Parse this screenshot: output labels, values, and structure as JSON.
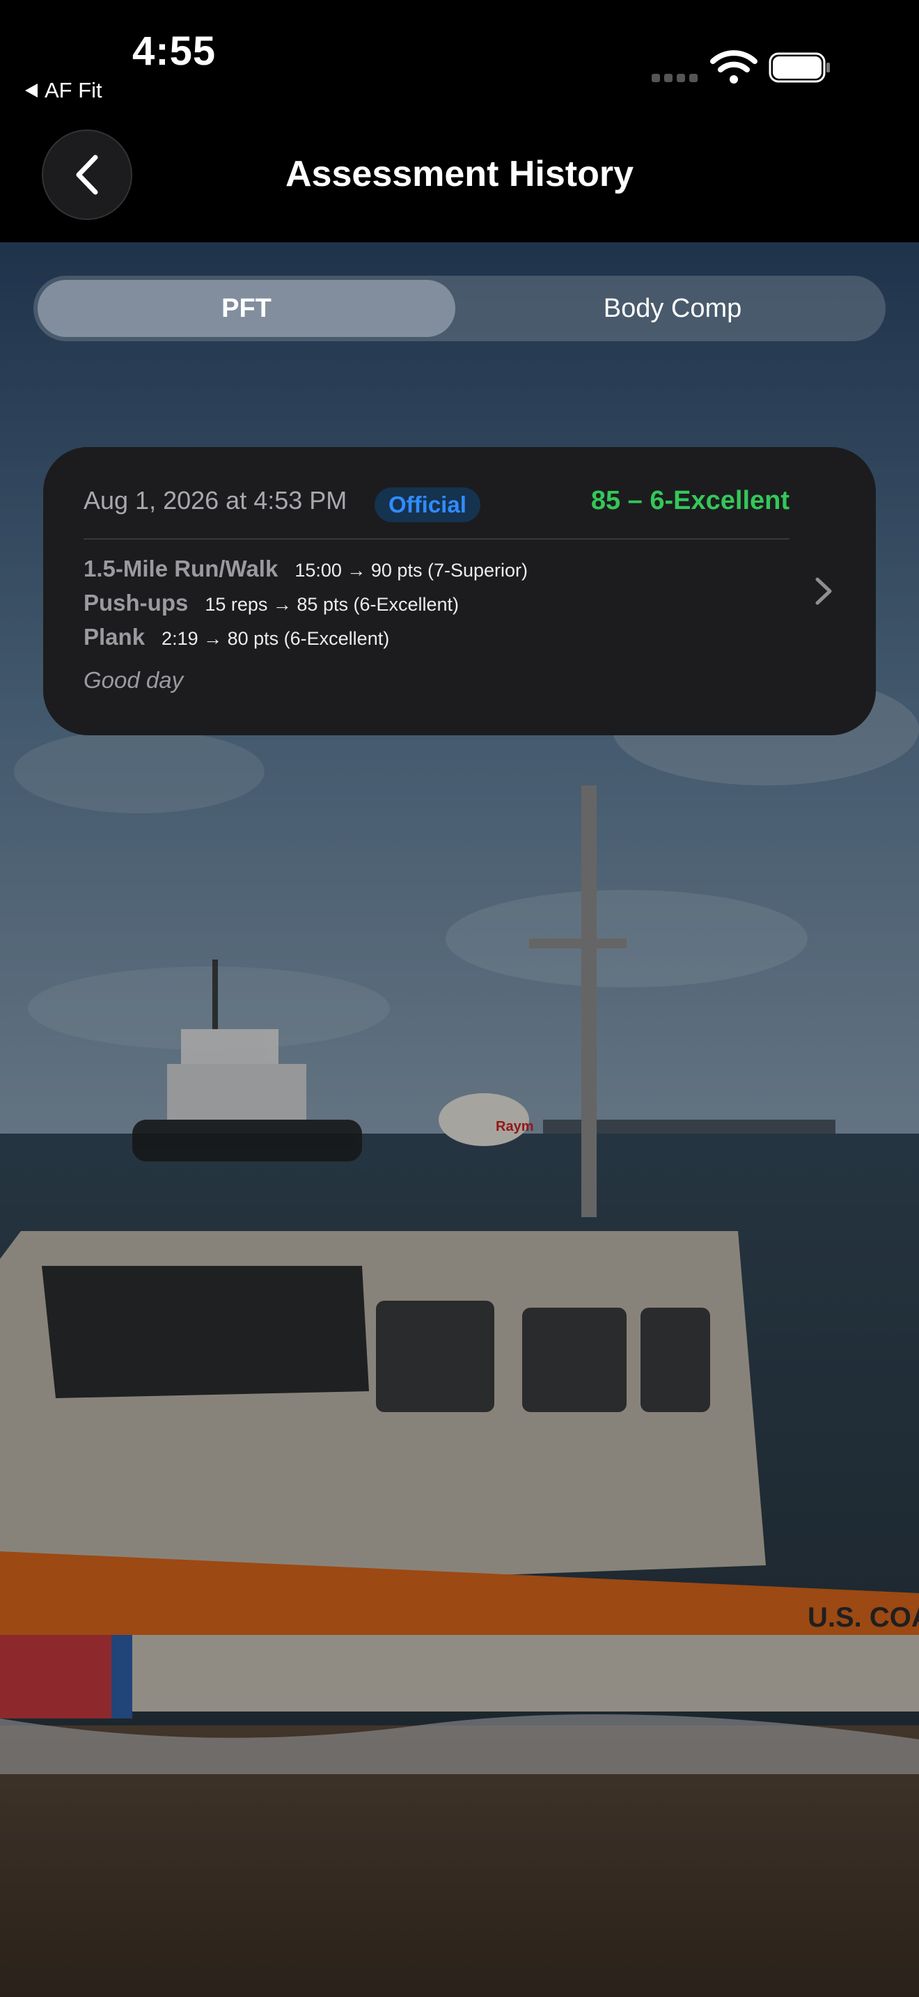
{
  "status_bar": {
    "time": "4:55",
    "back_app_label": "AF Fit"
  },
  "nav": {
    "title": "Assessment History"
  },
  "tabs": [
    {
      "label": "PFT",
      "selected": true
    },
    {
      "label": "Body Comp",
      "selected": false
    }
  ],
  "assessments": [
    {
      "date": "Aug 1, 2026 at 4:53 PM",
      "badge": "Official",
      "score": "85 – 6-Excellent",
      "components": [
        {
          "event": "1.5-Mile Run/Walk",
          "result": "15:00 → 90 pts (7-Superior)"
        },
        {
          "event": "Push-ups",
          "result": "15 reps → 85 pts (6-Excellent)"
        },
        {
          "event": "Plank",
          "result": "2:19 → 80 pts (6-Excellent)"
        }
      ],
      "note": "Good day"
    }
  ],
  "background": {
    "description_text": "",
    "boat_hull_text": "U.S. COAS",
    "radar_text": "Raym"
  },
  "colors": {
    "accent_green": "#34c759",
    "badge_blue": "#2f8cff",
    "card_bg": "#1c1c1e"
  },
  "icons": [
    "back-chevron-icon",
    "wifi-icon",
    "battery-icon",
    "chevron-right-icon",
    "back-triangle-icon"
  ]
}
